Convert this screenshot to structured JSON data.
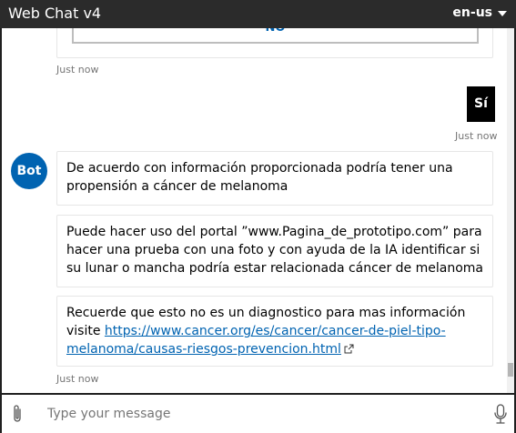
{
  "window": {
    "title": "Web Chat v4",
    "locale": "en-us"
  },
  "transcript": {
    "prev_card_button": "NO",
    "prev_timestamp": "Just now",
    "user_message": "Sí",
    "user_timestamp": "Just now",
    "bot_avatar": "Bot",
    "bot_messages": [
      {
        "text": "De acuerdo con información proporcionada podría tener una propensión a cáncer de melanoma"
      },
      {
        "text": "Puede hacer uso del portal ”www.Pagina_de_prototipo.com” para hacer una prueba con una foto y con ayuda de la IA identificar si su lunar o mancha podría estar relacionada cáncer de melanoma"
      },
      {
        "text": "Recuerde que esto no es un diagnostico para mas información visite",
        "link": "https://www.cancer.org/es/cancer/cancer-de-piel-tipo-melanoma/causas-riesgos-prevencion.html"
      }
    ],
    "bot_timestamp": "Just now"
  },
  "composer": {
    "placeholder": "Type your message"
  },
  "icons": {
    "attach": "paperclip-icon",
    "mic": "microphone-icon",
    "external": "external-link-icon",
    "dropdown": "caret-down-icon"
  },
  "colors": {
    "accent": "#0063b1",
    "titlebar": "#2b2b2b",
    "user_bubble": "#000000"
  }
}
